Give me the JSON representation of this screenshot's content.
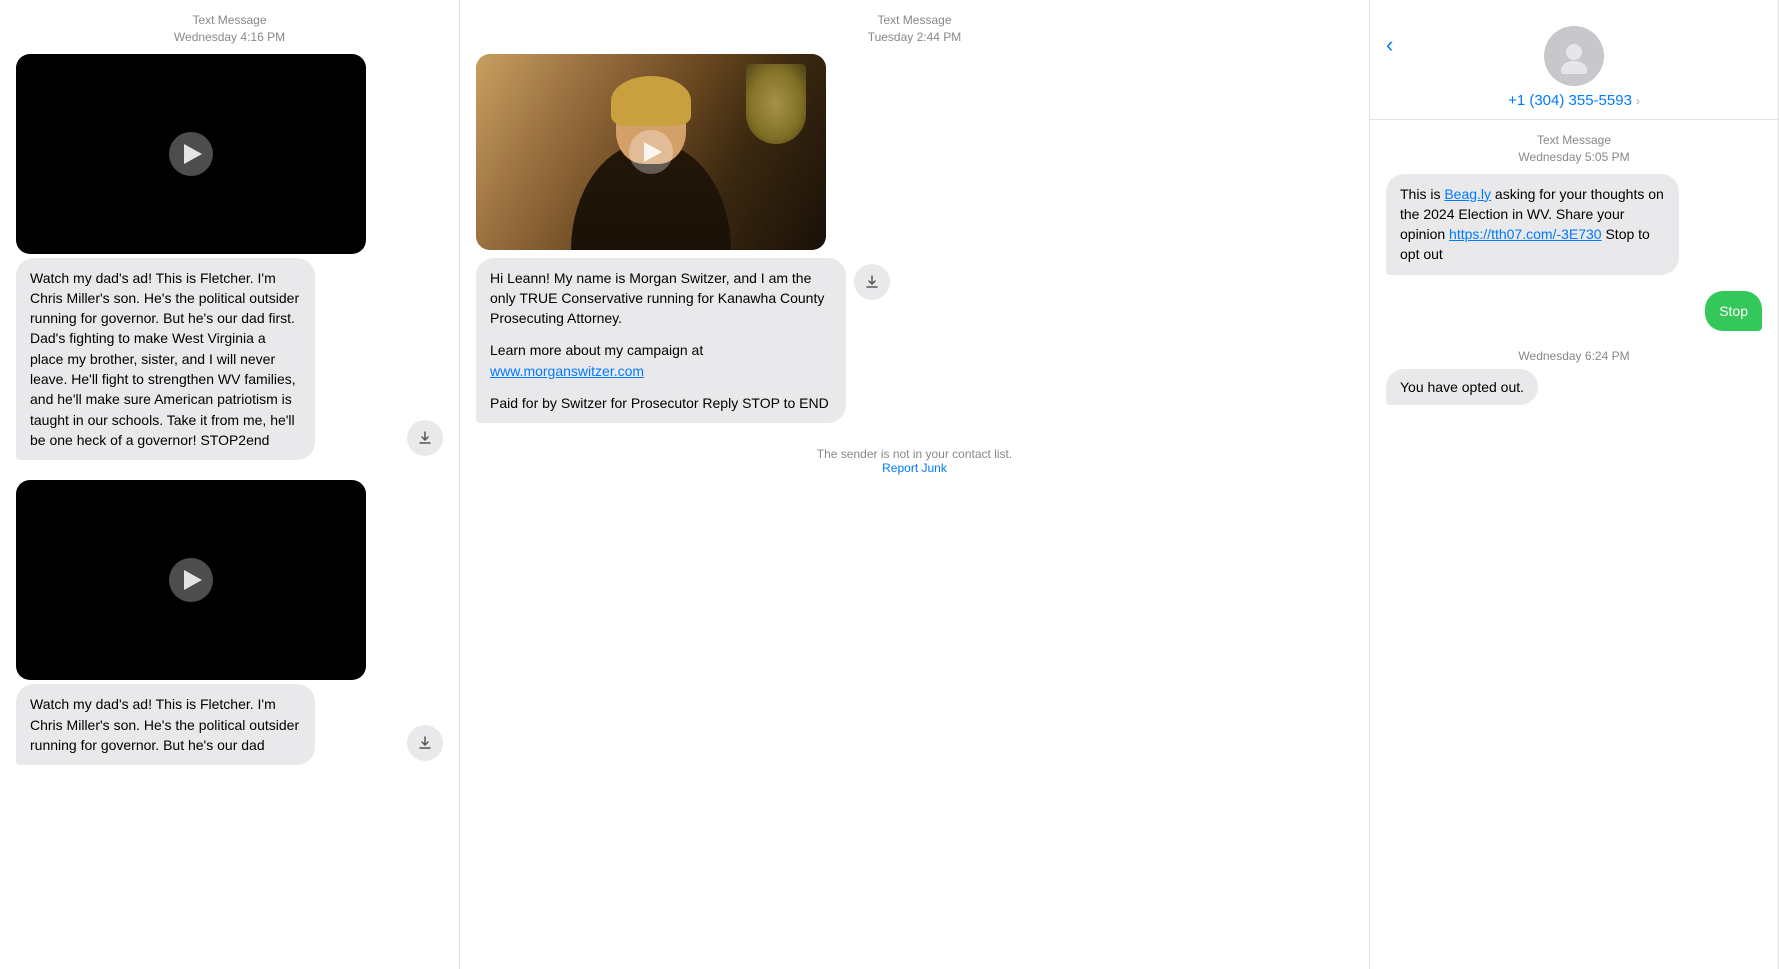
{
  "columns": {
    "left": {
      "messages": [
        {
          "timestamp_label": "Text Message",
          "timestamp_time": "Wednesday 4:16 PM",
          "has_video": true,
          "text": "Watch my dad's ad! This is Fletcher. I'm Chris Miller's son. He's the political outsider running for governor. But he's our dad first. Dad's fighting to make West Virginia a place my brother, sister, and I will never leave. He'll fight to strengthen WV families, and he'll make sure American patriotism is taught in our schools. Take it from me, he'll be one heck of a governor!\nSTOP2end"
        },
        {
          "has_video": true,
          "text": "Watch my dad's ad! This is Fletcher. I'm Chris Miller's son. He's the political outsider running for governor. But he's our dad"
        }
      ]
    },
    "mid": {
      "timestamp_label": "Text Message",
      "timestamp_time": "Tuesday 2:44 PM",
      "has_photo": true,
      "text_part1": "Hi Leann! My name is Morgan Switzer, and I am the only TRUE Conservative running for Kanawha County Prosecuting Attorney.",
      "text_part2": "Learn more about my campaign at",
      "link": "www.morganswitzer.com",
      "text_part3": "Paid for by Switzer for Prosecutor\nReply STOP to END",
      "sender_not_in_contacts": "The sender is not in your contact list.",
      "report_junk": "Report Junk"
    },
    "right": {
      "back_label": "‹",
      "phone_number": "+1 (304) 355-5593",
      "chevron": "›",
      "message1": {
        "timestamp_label": "Text Message",
        "timestamp_time": "Wednesday 5:05 PM",
        "text_before_link1": "This is ",
        "link1_text": "Beag.ly",
        "link1_href": "http://Beag.ly",
        "text_after_link1": " asking for your thoughts on the 2024 Election in WV. Share your opinion ",
        "link2_text": "https://tth07.com/-3E730",
        "link2_href": "https://tth07.com/-3E730",
        "text_after_link2": " Stop to opt out"
      },
      "stop_reply": "Stop",
      "divider_time": "Wednesday 6:24 PM",
      "opted_out_text": "You have opted out."
    }
  }
}
